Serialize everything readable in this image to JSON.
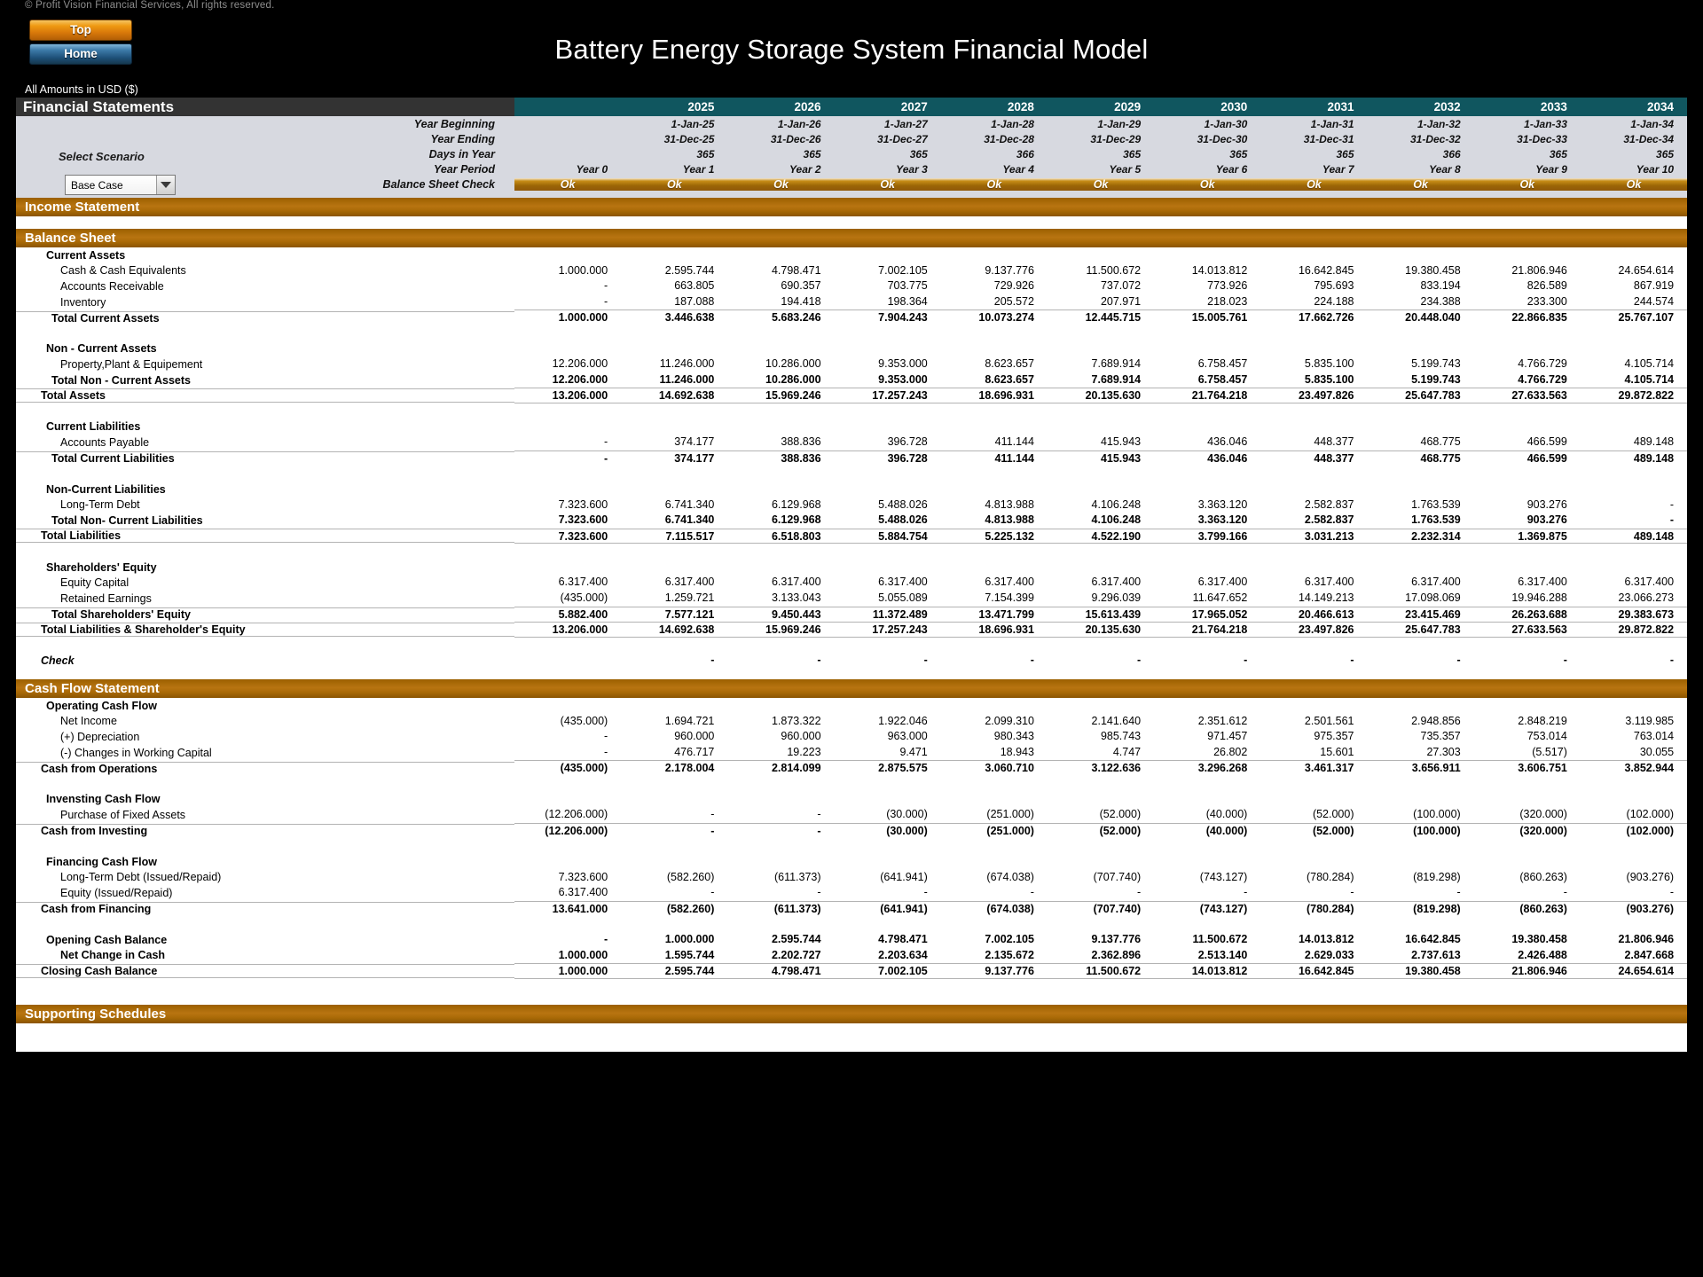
{
  "window": {
    "copyright": "© Profit Vision Financial Services, All rights reserved.",
    "title": "Battery Energy Storage System Financial Model",
    "all_amounts": "All Amounts in  USD ($)"
  },
  "nav": {
    "top_label": "Top",
    "home_label": "Home"
  },
  "header": {
    "section_title": "Financial Statements",
    "scenario_label": "Select Scenario",
    "scenario_value": "Base Case",
    "scenario_options": [
      "Base Case"
    ],
    "years": [
      "2025",
      "2026",
      "2027",
      "2028",
      "2029",
      "2030",
      "2031",
      "2032",
      "2033",
      "2034"
    ],
    "rows": [
      {
        "label": "Year Beginning",
        "values": [
          "",
          "1-Jan-25",
          "1-Jan-26",
          "1-Jan-27",
          "1-Jan-28",
          "1-Jan-29",
          "1-Jan-30",
          "1-Jan-31",
          "1-Jan-32",
          "1-Jan-33",
          "1-Jan-34"
        ]
      },
      {
        "label": "Year Ending",
        "values": [
          "",
          "31-Dec-25",
          "31-Dec-26",
          "31-Dec-27",
          "31-Dec-28",
          "31-Dec-29",
          "31-Dec-30",
          "31-Dec-31",
          "31-Dec-32",
          "31-Dec-33",
          "31-Dec-34"
        ]
      },
      {
        "label": "Days in Year",
        "values": [
          "",
          "365",
          "365",
          "365",
          "366",
          "365",
          "365",
          "365",
          "366",
          "365",
          "365"
        ]
      },
      {
        "label": "Year Period",
        "values": [
          "Year 0",
          "Year 1",
          "Year 2",
          "Year 3",
          "Year 4",
          "Year 5",
          "Year 6",
          "Year 7",
          "Year 8",
          "Year 9",
          "Year 10"
        ]
      }
    ],
    "balance_check": {
      "label": "Balance Sheet Check",
      "values": [
        "Ok",
        "Ok",
        "Ok",
        "Ok",
        "Ok",
        "Ok",
        "Ok",
        "Ok",
        "Ok",
        "Ok",
        "Ok"
      ]
    }
  },
  "sections": {
    "income_statement": "Income Statement",
    "balance_sheet": "Balance Sheet",
    "cash_flow_statement": "Cash Flow Statement",
    "supporting_schedules": "Supporting Schedules"
  },
  "balance_sheet": {
    "h_current_assets": "Current Assets",
    "r_cash": {
      "label": "Cash & Cash Equivalents",
      "values": [
        "1.000.000",
        "2.595.744",
        "4.798.471",
        "7.002.105",
        "9.137.776",
        "11.500.672",
        "14.013.812",
        "16.642.845",
        "19.380.458",
        "21.806.946",
        "24.654.614"
      ]
    },
    "r_ar": {
      "label": "Accounts Receivable",
      "values": [
        "-",
        "663.805",
        "690.357",
        "703.775",
        "729.926",
        "737.072",
        "773.926",
        "795.693",
        "833.194",
        "826.589",
        "867.919"
      ]
    },
    "r_inv": {
      "label": "Inventory",
      "values": [
        "-",
        "187.088",
        "194.418",
        "198.364",
        "205.572",
        "207.971",
        "218.023",
        "224.188",
        "234.388",
        "233.300",
        "244.574"
      ]
    },
    "r_tca": {
      "label": "Total Current Assets",
      "values": [
        "1.000.000",
        "3.446.638",
        "5.683.246",
        "7.904.243",
        "10.073.274",
        "12.445.715",
        "15.005.761",
        "17.662.726",
        "20.448.040",
        "22.866.835",
        "25.767.107"
      ]
    },
    "h_noncurrent_assets": "Non - Current Assets",
    "r_ppe": {
      "label": "Property,Plant & Equipement",
      "values": [
        "12.206.000",
        "11.246.000",
        "10.286.000",
        "9.353.000",
        "8.623.657",
        "7.689.914",
        "6.758.457",
        "5.835.100",
        "5.199.743",
        "4.766.729",
        "4.105.714"
      ]
    },
    "r_tnca": {
      "label": "Total Non - Current Assets",
      "values": [
        "12.206.000",
        "11.246.000",
        "10.286.000",
        "9.353.000",
        "8.623.657",
        "7.689.914",
        "6.758.457",
        "5.835.100",
        "5.199.743",
        "4.766.729",
        "4.105.714"
      ]
    },
    "r_ta": {
      "label": "Total Assets",
      "values": [
        "13.206.000",
        "14.692.638",
        "15.969.246",
        "17.257.243",
        "18.696.931",
        "20.135.630",
        "21.764.218",
        "23.497.826",
        "25.647.783",
        "27.633.563",
        "29.872.822"
      ]
    },
    "h_current_liab": "Current Liabilities",
    "r_ap": {
      "label": "Accounts Payable",
      "values": [
        "-",
        "374.177",
        "388.836",
        "396.728",
        "411.144",
        "415.943",
        "436.046",
        "448.377",
        "468.775",
        "466.599",
        "489.148"
      ]
    },
    "r_tcl": {
      "label": "Total Current Liabilities",
      "values": [
        "-",
        "374.177",
        "388.836",
        "396.728",
        "411.144",
        "415.943",
        "436.046",
        "448.377",
        "468.775",
        "466.599",
        "489.148"
      ]
    },
    "h_noncurrent_liab": "Non-Current Liabilities",
    "r_ltd": {
      "label": "Long-Term Debt",
      "values": [
        "7.323.600",
        "6.741.340",
        "6.129.968",
        "5.488.026",
        "4.813.988",
        "4.106.248",
        "3.363.120",
        "2.582.837",
        "1.763.539",
        "903.276",
        "-"
      ]
    },
    "r_tncl": {
      "label": "Total Non- Current Liabilities",
      "values": [
        "7.323.600",
        "6.741.340",
        "6.129.968",
        "5.488.026",
        "4.813.988",
        "4.106.248",
        "3.363.120",
        "2.582.837",
        "1.763.539",
        "903.276",
        "-"
      ]
    },
    "r_tl": {
      "label": "Total Liabilities",
      "values": [
        "7.323.600",
        "7.115.517",
        "6.518.803",
        "5.884.754",
        "5.225.132",
        "4.522.190",
        "3.799.166",
        "3.031.213",
        "2.232.314",
        "1.369.875",
        "489.148"
      ]
    },
    "h_equity": "Shareholders' Equity",
    "r_eq_cap": {
      "label": "Equity Capital",
      "values": [
        "6.317.400",
        "6.317.400",
        "6.317.400",
        "6.317.400",
        "6.317.400",
        "6.317.400",
        "6.317.400",
        "6.317.400",
        "6.317.400",
        "6.317.400",
        "6.317.400"
      ]
    },
    "r_re": {
      "label": "Retained Earnings",
      "values": [
        "(435.000)",
        "1.259.721",
        "3.133.043",
        "5.055.089",
        "7.154.399",
        "9.296.039",
        "11.647.652",
        "14.149.213",
        "17.098.069",
        "19.946.288",
        "23.066.273"
      ]
    },
    "r_tse": {
      "label": "Total Shareholders' Equity",
      "values": [
        "5.882.400",
        "7.577.121",
        "9.450.443",
        "11.372.489",
        "13.471.799",
        "15.613.439",
        "17.965.052",
        "20.466.613",
        "23.415.469",
        "26.263.688",
        "29.383.673"
      ]
    },
    "r_tlse": {
      "label": "Total Liabilities & Shareholder's Equity",
      "values": [
        "13.206.000",
        "14.692.638",
        "15.969.246",
        "17.257.243",
        "18.696.931",
        "20.135.630",
        "21.764.218",
        "23.497.826",
        "25.647.783",
        "27.633.563",
        "29.872.822"
      ]
    },
    "r_check": {
      "label": "Check",
      "values": [
        "",
        "-",
        "-",
        "-",
        "-",
        "-",
        "-",
        "-",
        "-",
        "-",
        "-"
      ]
    }
  },
  "cash_flow": {
    "h_operating": "Operating Cash Flow",
    "r_ni": {
      "label": "Net Income",
      "values": [
        "(435.000)",
        "1.694.721",
        "1.873.322",
        "1.922.046",
        "2.099.310",
        "2.141.640",
        "2.351.612",
        "2.501.561",
        "2.948.856",
        "2.848.219",
        "3.119.985"
      ]
    },
    "r_dep": {
      "label": "(+) Depreciation",
      "values": [
        "-",
        "960.000",
        "960.000",
        "963.000",
        "980.343",
        "985.743",
        "971.457",
        "975.357",
        "735.357",
        "753.014",
        "763.014"
      ]
    },
    "r_wc": {
      "label": "(-) Changes in Working Capital",
      "values": [
        "-",
        "476.717",
        "19.223",
        "9.471",
        "18.943",
        "4.747",
        "26.802",
        "15.601",
        "27.303",
        "(5.517)",
        "30.055"
      ]
    },
    "r_cfo": {
      "label": "Cash from Operations",
      "values": [
        "(435.000)",
        "2.178.004",
        "2.814.099",
        "2.875.575",
        "3.060.710",
        "3.122.636",
        "3.296.268",
        "3.461.317",
        "3.656.911",
        "3.606.751",
        "3.852.944"
      ]
    },
    "h_investing": "Invensting Cash Flow",
    "r_pfa": {
      "label": "Purchase of Fixed Assets",
      "values": [
        "(12.206.000)",
        "-",
        "-",
        "(30.000)",
        "(251.000)",
        "(52.000)",
        "(40.000)",
        "(52.000)",
        "(100.000)",
        "(320.000)",
        "(102.000)"
      ]
    },
    "r_cfi": {
      "label": "Cash from Investing",
      "values": [
        "(12.206.000)",
        "-",
        "-",
        "(30.000)",
        "(251.000)",
        "(52.000)",
        "(40.000)",
        "(52.000)",
        "(100.000)",
        "(320.000)",
        "(102.000)"
      ]
    },
    "h_financing": "Financing Cash Flow",
    "r_ltd": {
      "label": "Long-Term Debt (Issued/Repaid)",
      "values": [
        "7.323.600",
        "(582.260)",
        "(611.373)",
        "(641.941)",
        "(674.038)",
        "(707.740)",
        "(743.127)",
        "(780.284)",
        "(819.298)",
        "(860.263)",
        "(903.276)"
      ]
    },
    "r_eq": {
      "label": "Equity (Issued/Repaid)",
      "values": [
        "6.317.400",
        "-",
        "-",
        "-",
        "-",
        "-",
        "-",
        "-",
        "-",
        "-",
        "-"
      ]
    },
    "r_cff": {
      "label": "Cash from Financing",
      "values": [
        "13.641.000",
        "(582.260)",
        "(611.373)",
        "(641.941)",
        "(674.038)",
        "(707.740)",
        "(743.127)",
        "(780.284)",
        "(819.298)",
        "(860.263)",
        "(903.276)"
      ]
    },
    "r_open": {
      "label": "Opening Cash Balance",
      "values": [
        "-",
        "1.000.000",
        "2.595.744",
        "4.798.471",
        "7.002.105",
        "9.137.776",
        "11.500.672",
        "14.013.812",
        "16.642.845",
        "19.380.458",
        "21.806.946"
      ]
    },
    "r_net": {
      "label": "Net Change in Cash",
      "values": [
        "1.000.000",
        "1.595.744",
        "2.202.727",
        "2.203.634",
        "2.135.672",
        "2.362.896",
        "2.513.140",
        "2.629.033",
        "2.737.613",
        "2.426.488",
        "2.847.668"
      ]
    },
    "r_close": {
      "label": "Closing Cash Balance",
      "values": [
        "1.000.000",
        "2.595.744",
        "4.798.471",
        "7.002.105",
        "9.137.776",
        "11.500.672",
        "14.013.812",
        "16.642.845",
        "19.380.458",
        "21.806.946",
        "24.654.614"
      ]
    }
  },
  "colors": {
    "banner": "#a96a07",
    "year_header": "#10565f",
    "section_label": "#333333",
    "info_bg": "#d7d9e0"
  }
}
